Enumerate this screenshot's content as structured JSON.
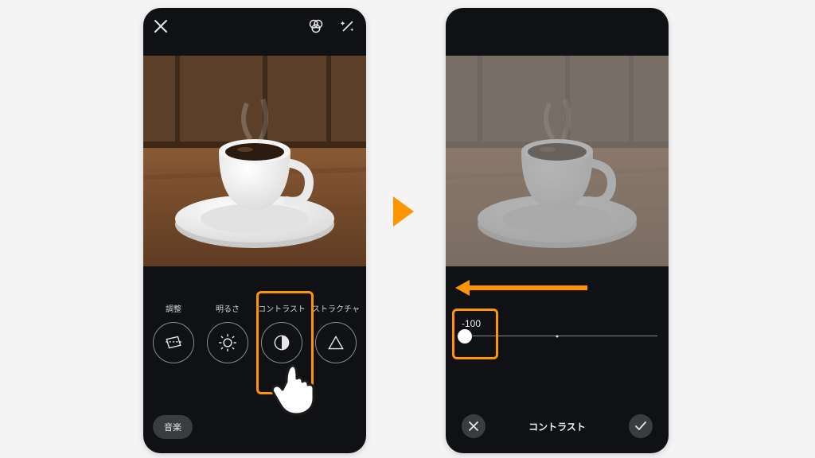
{
  "colors": {
    "highlight": "#ff9500",
    "bg": "#0f1114"
  },
  "left": {
    "tools": [
      {
        "label": "調整",
        "icon": "adjust-icon"
      },
      {
        "label": "明るさ",
        "icon": "brightness-icon"
      },
      {
        "label": "コントラスト",
        "icon": "contrast-icon"
      },
      {
        "label": "ストラクチャ",
        "icon": "structure-icon"
      }
    ],
    "music_label": "音楽",
    "highlighted_tool_index": 2
  },
  "right": {
    "slider": {
      "value_label": "-100",
      "value": -100,
      "min": -100,
      "max": 100
    },
    "confirm_title": "コントラスト"
  }
}
